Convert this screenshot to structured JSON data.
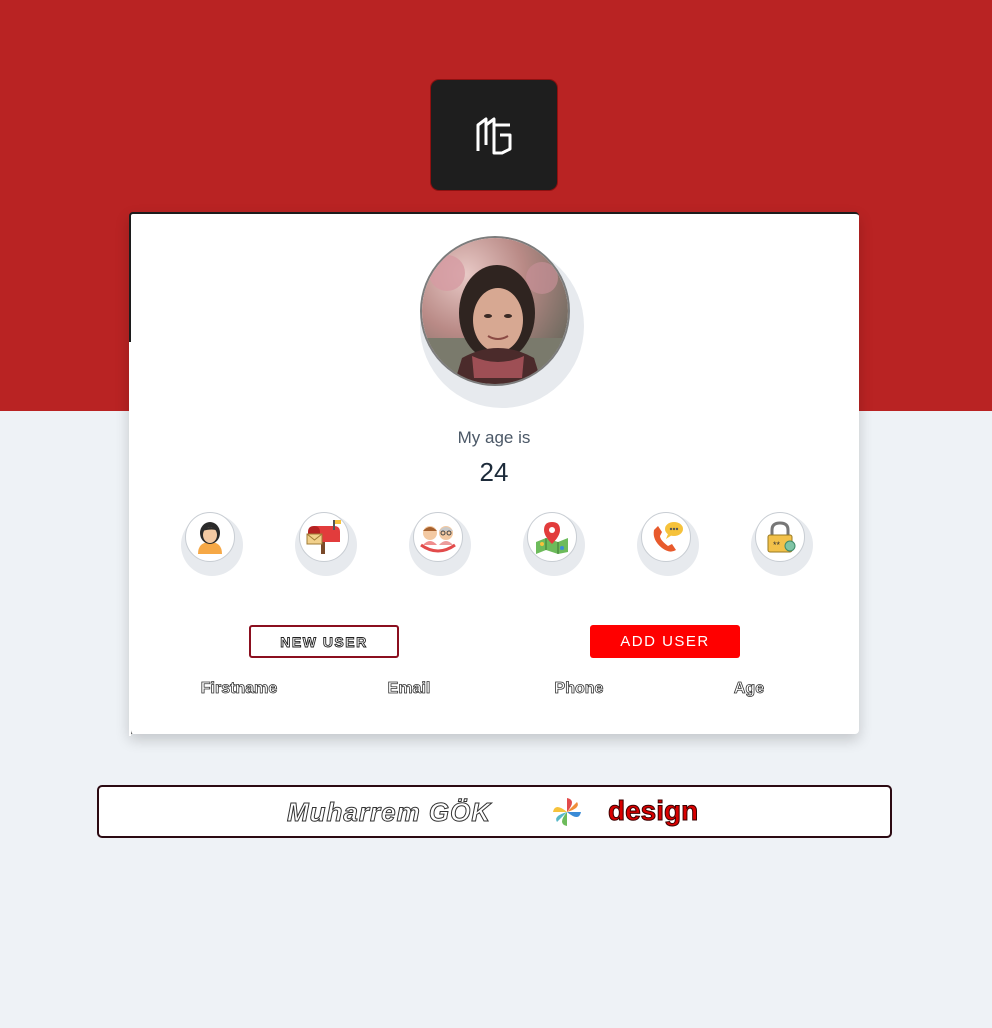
{
  "profile": {
    "label": "My age is",
    "value": "24",
    "icons": [
      "user-icon",
      "mailbox-icon",
      "age-icon",
      "map-location-icon",
      "phone-icon",
      "lock-icon"
    ]
  },
  "buttons": {
    "new_user": "NEW USER",
    "add_user": "ADD USER"
  },
  "table": {
    "headers": [
      "Firstname",
      "Email",
      "Phone",
      "Age"
    ]
  },
  "footer": {
    "name": "Muharrem GÖK",
    "design": "design"
  },
  "colors": {
    "band": "#b92323",
    "background": "#eef2f6",
    "accent": "#ff0000",
    "logo_bg": "#1e1e1e"
  }
}
